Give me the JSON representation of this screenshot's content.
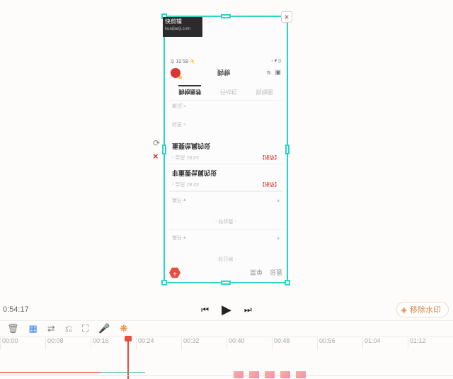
{
  "watermark": {
    "line1": "快剪辑",
    "line2": "kuaijianji.com"
  },
  "phone": {
    "top_icons": [
      "菜单",
      "设置"
    ],
    "section_a": "- 好日常 -",
    "expand_a": "展开 ▾",
    "section_b": "- 好花费 -",
    "expand_b": "展开 ▾",
    "card1": {
      "meta_left": "◦ 会员 18:53",
      "meta_right": "【推荐】",
      "title": "非重要信属的设"
    },
    "card2": {
      "meta_left": "◦ 会员 18:53",
      "meta_right": "【推荐】",
      "title": "重要信属的设"
    },
    "mini1": "标签 >",
    "mini2": "概况 >",
    "tabs": [
      "购物推荐",
      "行动栏",
      "购物圈"
    ],
    "status_title": "购物",
    "sys_time": "⏱ 15:28 ⚡"
  },
  "playback": {
    "current_time": "0:54:17",
    "pill_label": "移除水印"
  },
  "ruler": [
    "00:00",
    "00:08",
    "00:16",
    "00:24",
    "00:32",
    "00:40",
    "00:48",
    "00:56",
    "01:04",
    "01:12"
  ]
}
